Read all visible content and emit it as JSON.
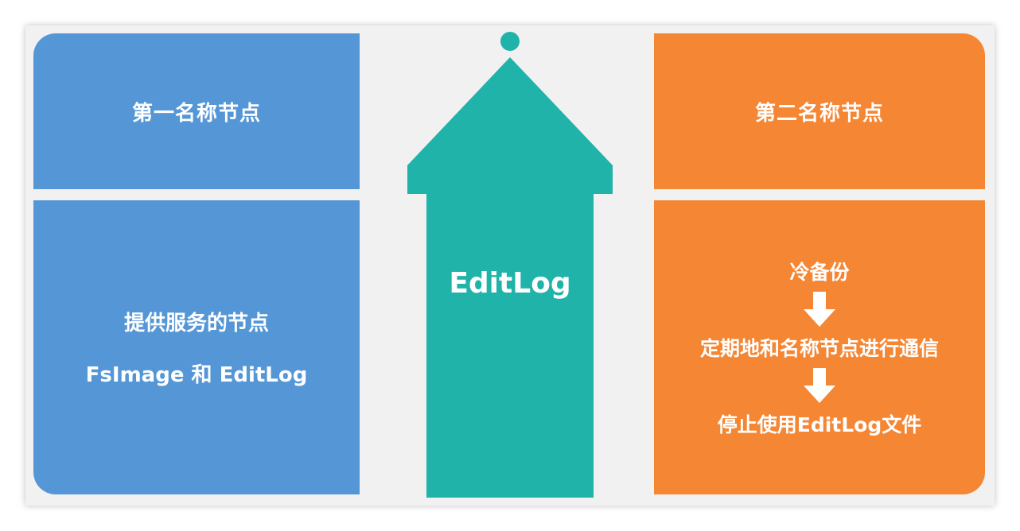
{
  "left": {
    "title": "第一名称节点",
    "line1": "提供服务的节点",
    "line2": "FsImage 和 EditLog"
  },
  "center": {
    "label": "EditLog"
  },
  "right": {
    "title": "第二名称节点",
    "steps": [
      "冷备份",
      "定期地和名称节点进行通信",
      "停止使用EditLog文件"
    ]
  },
  "colors": {
    "left_panel": "#5597d6",
    "right_panel": "#f58633",
    "arrow": "#1fb3aa"
  }
}
